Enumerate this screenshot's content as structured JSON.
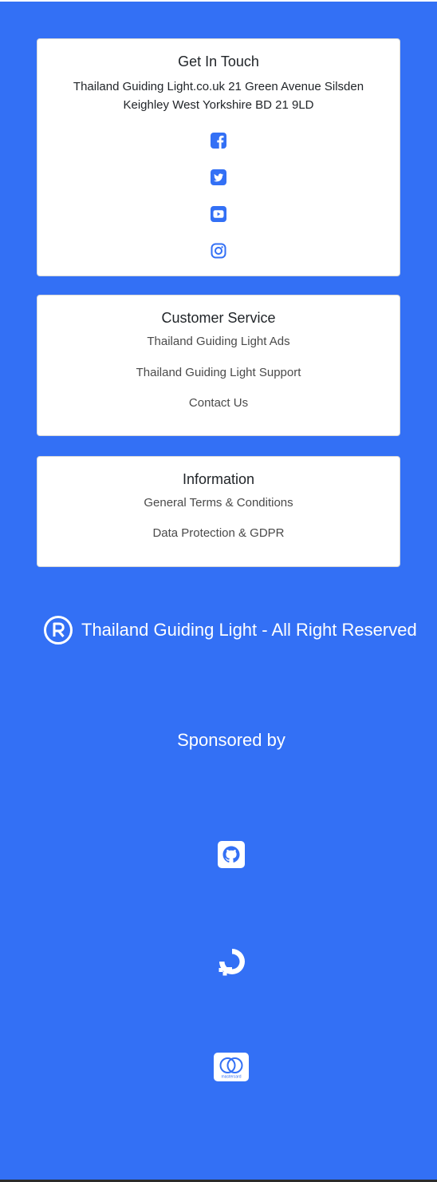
{
  "get_in_touch": {
    "title": "Get In Touch",
    "address_line1": "Thailand Guiding Light.co.uk 21 Green Avenue Silsden",
    "address_line2": "Keighley West Yorkshire BD 21 9LD",
    "social_icons": [
      "facebook-icon",
      "twitter-icon",
      "youtube-icon",
      "instagram-icon"
    ]
  },
  "customer_service": {
    "title": "Customer Service",
    "links": [
      "Thailand Guiding Light Ads",
      "Thailand Guiding Light Support",
      "Contact Us"
    ]
  },
  "information": {
    "title": "Information",
    "links": [
      "General Terms & Conditions",
      "Data Protection & GDPR"
    ]
  },
  "footer": {
    "copyright_text": "Thailand Guiding Light - All Right Reserved",
    "sponsored_label": "Sponsored by",
    "sponsor_icons": [
      "github-icon",
      "digitalocean-icon",
      "mastercard-icon"
    ],
    "mastercard_text": "mastercard"
  },
  "colors": {
    "background": "#3370f5",
    "card": "#ffffff",
    "icon_blue": "#3370f5",
    "text_dark": "#212529"
  }
}
